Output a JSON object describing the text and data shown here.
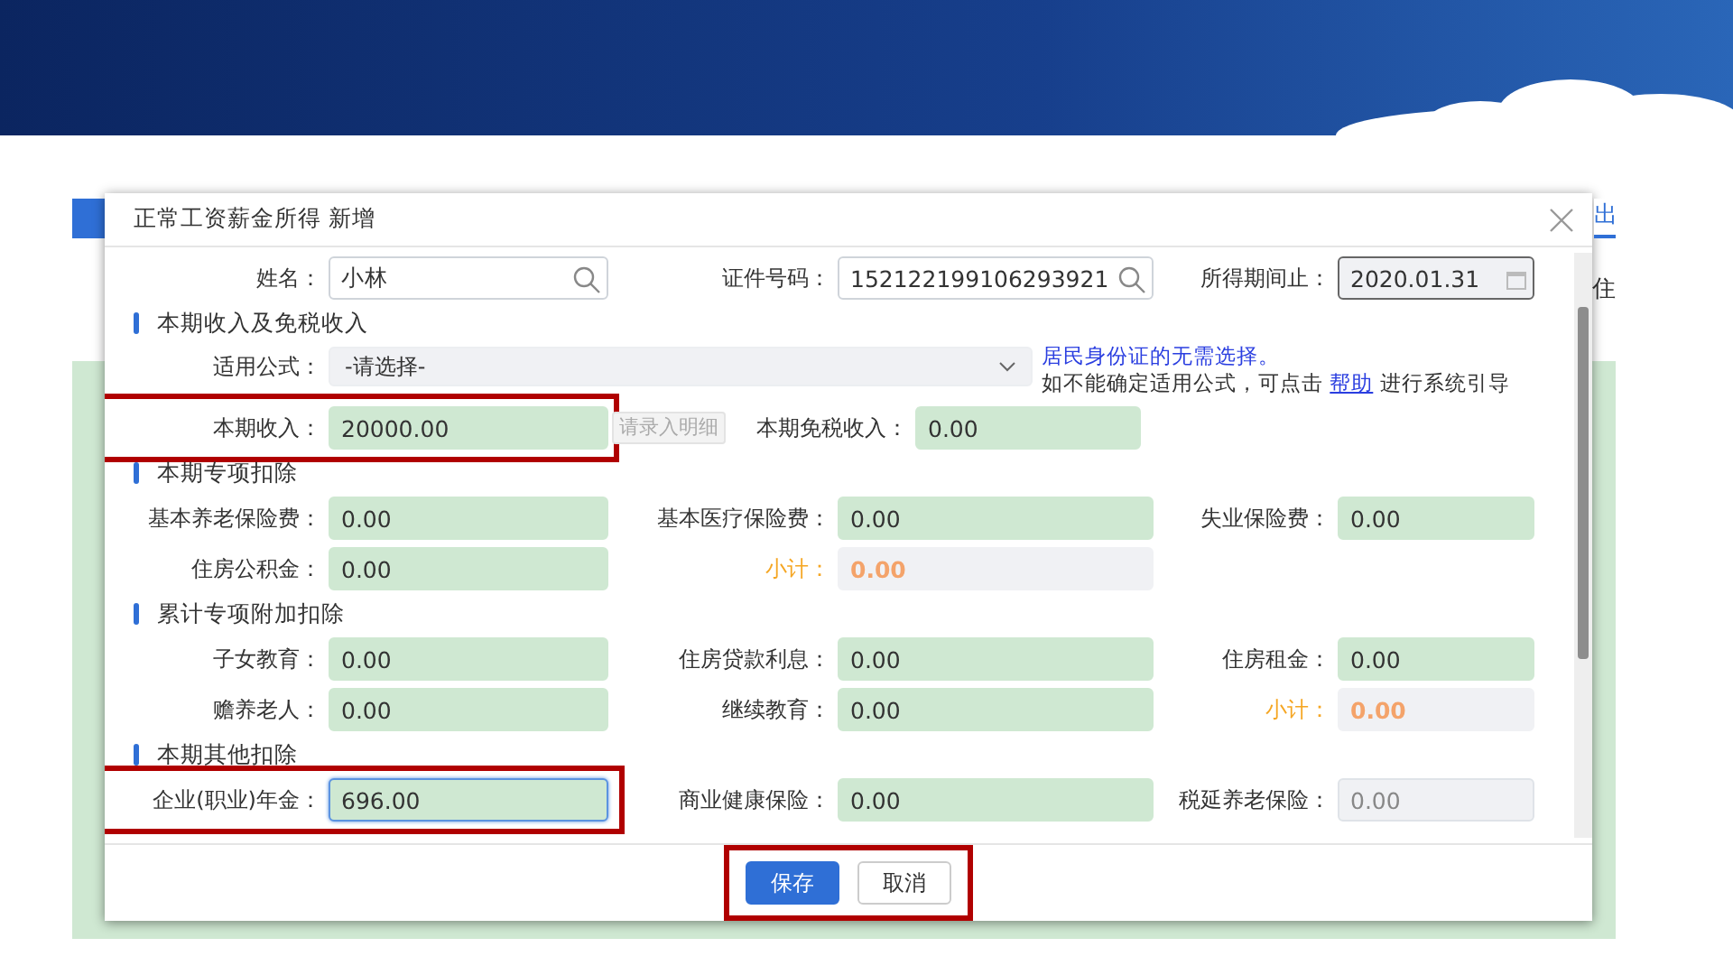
{
  "background": {
    "right_button": "出",
    "column_header": "住"
  },
  "dialog": {
    "title": "正常工资薪金所得 新增",
    "header_fields": [
      {
        "label": "姓名：",
        "value": "小林",
        "kind": "search"
      },
      {
        "label": "证件号码：",
        "value": "152122199106293921",
        "kind": "search"
      },
      {
        "label": "所得期间止：",
        "value": "2020.01.31",
        "kind": "date"
      }
    ],
    "income_section": {
      "title": "本期收入及免税收入",
      "formula": {
        "label": "适用公式：",
        "value": "-请选择-"
      },
      "note": {
        "line_1": "居民身份证的无需选择。",
        "line_2": "如不能确定适用公式，可点击 ",
        "link": "帮助",
        "line_2_end": " 进行系统引导"
      },
      "income": {
        "label": "本期收入：",
        "value": "20000.00",
        "highlighted": true
      },
      "detail_button": {
        "label": "请录入明细",
        "disabled": true
      },
      "tax_free": {
        "label": "本期免税收入：",
        "value": "0.00"
      }
    },
    "sections": [
      {
        "title": "本期专项扣除",
        "rows": [
          [
            {
              "kind": "input",
              "label": "基本养老保险费：",
              "value": "0.00"
            },
            {
              "kind": "input",
              "label": "基本医疗保险费：",
              "value": "0.00"
            },
            {
              "kind": "input",
              "label": "失业保险费：",
              "value": "0.00"
            }
          ],
          [
            {
              "kind": "input",
              "label": "住房公积金：",
              "value": "0.00"
            },
            {
              "kind": "subtotal",
              "label": "小计：",
              "value": "0.00"
            },
            null
          ]
        ]
      },
      {
        "title": "累计专项附加扣除",
        "rows": [
          [
            {
              "kind": "input",
              "label": "子女教育：",
              "value": "0.00"
            },
            {
              "kind": "input",
              "label": "住房贷款利息：",
              "value": "0.00"
            },
            {
              "kind": "input",
              "label": "住房租金：",
              "value": "0.00"
            }
          ],
          [
            {
              "kind": "input",
              "label": "赡养老人：",
              "value": "0.00"
            },
            {
              "kind": "input",
              "label": "继续教育：",
              "value": "0.00"
            },
            {
              "kind": "subtotal",
              "label": "小计：",
              "value": "0.00"
            }
          ]
        ]
      },
      {
        "title": "本期其他扣除",
        "rows": [
          [
            {
              "kind": "input",
              "label": "企业(职业)年金：",
              "value": "696.00",
              "highlighted": true,
              "focused": true
            },
            {
              "kind": "input",
              "label": "商业健康保险：",
              "value": "0.00"
            },
            {
              "kind": "readonly",
              "label": "税延养老保险：",
              "value": "0.00"
            }
          ]
        ]
      }
    ],
    "buttons": [
      {
        "label": "保存",
        "kind": "primary"
      },
      {
        "label": "取消",
        "kind": "secondary"
      }
    ],
    "footer_highlighted": true
  }
}
